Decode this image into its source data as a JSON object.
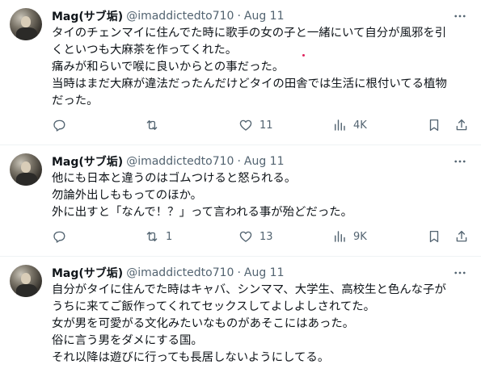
{
  "tweets": [
    {
      "name": "Mag(サブ垢)",
      "handle": "@imaddictedto710",
      "dot": "·",
      "time": "Aug 11",
      "lines": [
        "タイのチェンマイに住んでた時に歌手の女の子と一緒にいて自分が風邪を引",
        "くといつも大麻茶を作ってくれた。",
        "痛みが和らいで喉に良いからとの事だった。",
        "当時はまだ大麻が違法だったんだけどタイの田舎では生活に根付いてる植物",
        "だった。"
      ],
      "replies": "",
      "retweets": "",
      "likes": "11",
      "views": "4K"
    },
    {
      "name": "Mag(サブ垢)",
      "handle": "@imaddictedto710",
      "dot": "·",
      "time": "Aug 11",
      "lines": [
        "他にも日本と違うのはゴムつけると怒られる。",
        "勿論外出しももってのほか。",
        "外に出すと「なんで！？」って言われる事が殆どだった。"
      ],
      "replies": "",
      "retweets": "1",
      "likes": "13",
      "views": "9K"
    },
    {
      "name": "Mag(サブ垢)",
      "handle": "@imaddictedto710",
      "dot": "·",
      "time": "Aug 11",
      "lines": [
        "自分がタイに住んでた時はキャバ、シンママ、大学生、高校生と色んな子が",
        "うちに来てご飯作ってくれてセックスしてよしよしされてた。",
        "女が男を可愛がる文化みたいなものがあそこにはあった。",
        "俗に言う男をダメにする国。",
        "それ以降は遊びに行っても長居しないようにしてる。"
      ]
    }
  ],
  "icons": {
    "more": "more-horizontal-icon",
    "reply": "reply-icon",
    "retweet": "retweet-icon",
    "like": "heart-icon",
    "views": "views-chart-icon",
    "bookmark": "bookmark-icon",
    "share": "share-icon"
  },
  "colors": {
    "text": "#0f1419",
    "secondary": "#536471",
    "divider": "#eff3f4"
  }
}
